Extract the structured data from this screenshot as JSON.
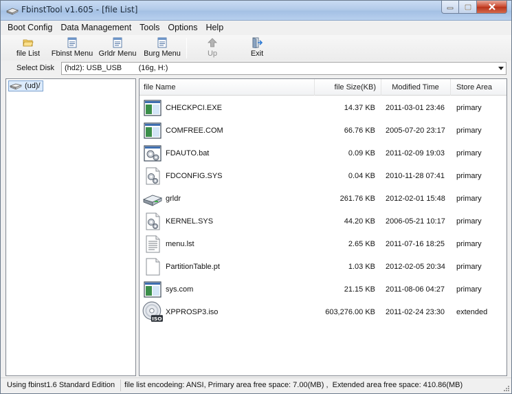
{
  "window": {
    "title": "FbinstTool v1.605 - [file List]"
  },
  "menu": [
    "Boot Config",
    "Data Management",
    "Tools",
    "Options",
    "Help"
  ],
  "toolbar": {
    "file_list": "file List",
    "fbinst_menu": "Fbinst Menu",
    "grldr_menu": "Grldr Menu",
    "burg_menu": "Burg Menu",
    "up": "Up",
    "exit": "Exit"
  },
  "disk": {
    "label": "Select Disk",
    "value": "(hd2): USB_USB        (16g, H:)"
  },
  "tree": {
    "root": "(ud)/"
  },
  "columns": {
    "name": "file Name",
    "size": "file Size(KB)",
    "modified": "Modified Time",
    "area": "Store Area"
  },
  "files": [
    {
      "name": "CHECKPCI.EXE",
      "size": "14.37 KB",
      "modified": "2011-03-01 23:46",
      "area": "primary",
      "icon": "exe-window-icon"
    },
    {
      "name": "COMFREE.COM",
      "size": "66.76 KB",
      "modified": "2005-07-20 23:17",
      "area": "primary",
      "icon": "exe-window-icon"
    },
    {
      "name": "FDAUTO.bat",
      "size": "0.09 KB",
      "modified": "2011-02-09 19:03",
      "area": "primary",
      "icon": "batch-gear-icon"
    },
    {
      "name": "FDCONFIG.SYS",
      "size": "0.04 KB",
      "modified": "2010-11-28 07:41",
      "area": "primary",
      "icon": "system-file-gear-icon"
    },
    {
      "name": "grldr",
      "size": "261.76 KB",
      "modified": "2012-02-01 15:48",
      "area": "primary",
      "icon": "drive-icon"
    },
    {
      "name": "KERNEL.SYS",
      "size": "44.20 KB",
      "modified": "2006-05-21 10:17",
      "area": "primary",
      "icon": "system-file-gear-icon"
    },
    {
      "name": "menu.lst",
      "size": "2.65 KB",
      "modified": "2011-07-16 18:25",
      "area": "primary",
      "icon": "text-document-icon"
    },
    {
      "name": "PartitionTable.pt",
      "size": "1.03 KB",
      "modified": "2012-02-05 20:34",
      "area": "primary",
      "icon": "blank-document-icon"
    },
    {
      "name": "sys.com",
      "size": "21.15 KB",
      "modified": "2011-08-06 04:27",
      "area": "primary",
      "icon": "exe-window-icon"
    },
    {
      "name": "XPPROSP3.iso",
      "size": "603,276.00 KB",
      "modified": "2011-02-24 23:30",
      "area": "extended",
      "icon": "iso-disc-icon"
    }
  ],
  "iso_badge": "ISO",
  "status": {
    "edition": "Using fbinst1.6 Standard Edition",
    "info": "file list encodeing: ANSI, Primary area free space: 7.00(MB) ,  Extended area free space: 410.86(MB)"
  },
  "colors": {
    "titlebar": "#b3cbe9",
    "close_button": "#c8452c",
    "selection": "#dcebfc"
  }
}
